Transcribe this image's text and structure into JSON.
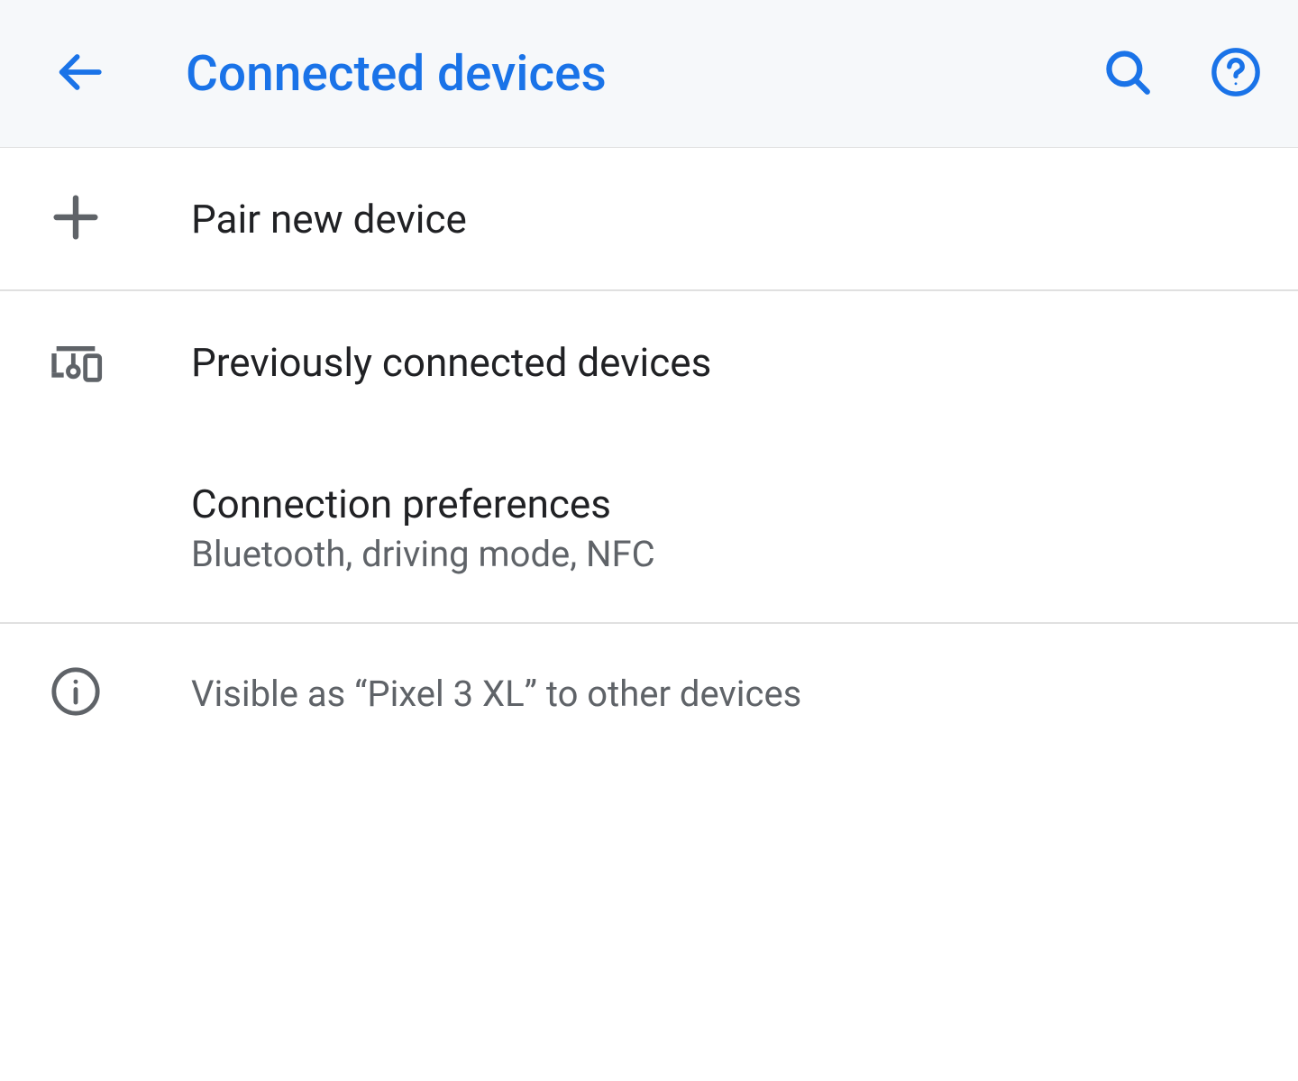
{
  "header": {
    "title": "Connected devices"
  },
  "items": {
    "pair": {
      "title": "Pair new device"
    },
    "previous": {
      "title": "Previously connected devices"
    },
    "prefs": {
      "title": "Connection preferences",
      "subtitle": "Bluetooth, driving mode, NFC"
    }
  },
  "info": {
    "text": "Visible as “Pixel 3 XL” to other devices"
  }
}
